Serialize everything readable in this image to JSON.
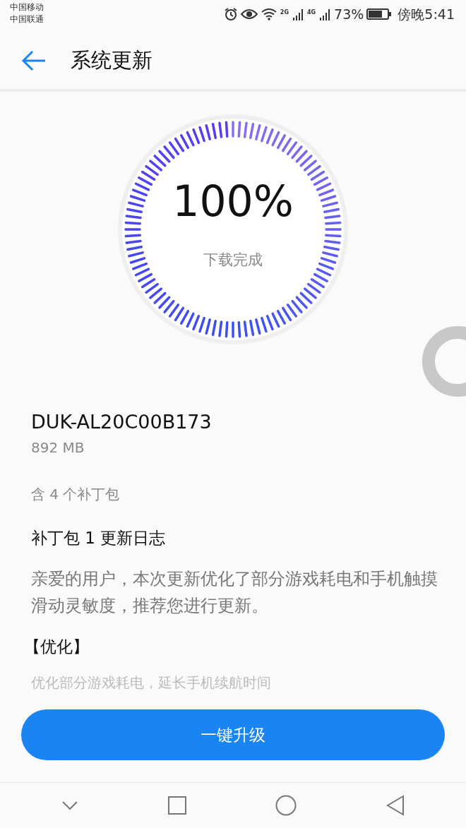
{
  "status_bar": {
    "carriers": [
      "中国移动",
      "中国联通"
    ],
    "network_1": "2G",
    "network_2": "4G",
    "battery": "73%",
    "time": "傍晚5:41"
  },
  "header": {
    "title": "系统更新"
  },
  "progress": {
    "percent": "100%",
    "status": "下载完成"
  },
  "package": {
    "version": "DUK-AL20C00B173",
    "size": "892 MB",
    "patch_count": "含 4 个补丁包"
  },
  "changelog": {
    "title": "补丁包 1 更新日志",
    "intro": "亲爱的用户，本次更新优化了部分游戏耗电和手机触摸滑动灵敏度，推荐您进行更新。",
    "section": "【优化】",
    "item": "优化部分游戏耗电，延长手机续航时间"
  },
  "button": {
    "label": "一键升级"
  }
}
